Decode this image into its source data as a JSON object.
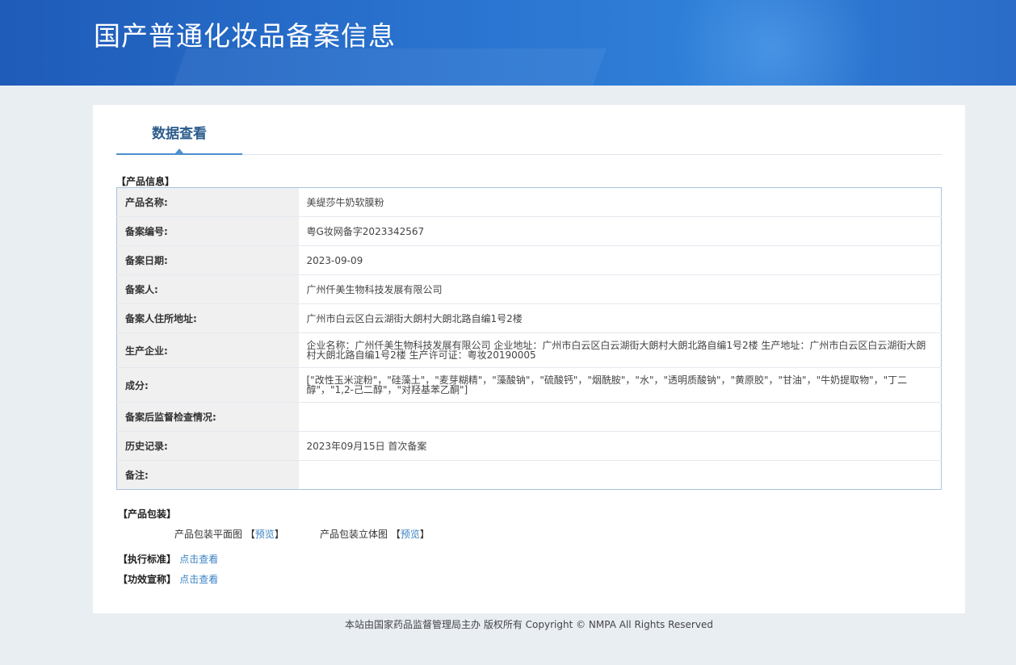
{
  "header": {
    "title": "国产普通化妆品备案信息"
  },
  "tab": {
    "label": "数据查看"
  },
  "product_info": {
    "section_label": "【产品信息】",
    "rows": [
      {
        "label": "产品名称:",
        "value": "美缇莎牛奶软膜粉"
      },
      {
        "label": "备案编号:",
        "value": "粤G妆网备字2023342567"
      },
      {
        "label": "备案日期:",
        "value": "2023-09-09"
      },
      {
        "label": "备案人:",
        "value": "广州仟美生物科技发展有限公司"
      },
      {
        "label": "备案人住所地址:",
        "value": "广州市白云区白云湖街大朗村大朗北路自编1号2楼"
      },
      {
        "label": "生产企业:",
        "value": "企业名称：广州仟美生物科技发展有限公司 企业地址：广州市白云区白云湖街大朗村大朗北路自编1号2楼 生产地址：广州市白云区白云湖街大朗村大朗北路自编1号2楼 生产许可证：粤妆20190005"
      },
      {
        "label": "成分:",
        "value": "[\"改性玉米淀粉\"，\"硅藻土\"，\"麦芽糊精\"，\"藻酸钠\"，\"硫酸钙\"，\"烟酰胺\"，\"水\"，\"透明质酸钠\"，\"黄原胶\"，\"甘油\"，\"牛奶提取物\"，\"丁二醇\"，\"1,2-己二醇\"，\"对羟基苯乙酮\"]"
      },
      {
        "label": "备案后监督检查情况:",
        "value": ""
      },
      {
        "label": "历史记录:",
        "value": "2023年09月15日 首次备案"
      },
      {
        "label": "备注:",
        "value": ""
      }
    ]
  },
  "packaging": {
    "section_label": "【产品包装】",
    "flat_label": "产品包装平面图",
    "flat_link": "预览",
    "stereo_label": "产品包装立体图",
    "stereo_link": "预览"
  },
  "standard": {
    "label": "【执行标准】",
    "link": "点击查看"
  },
  "efficacy": {
    "label": "【功效宣称】",
    "link": "点击查看"
  },
  "footer": {
    "text": "本站由国家药品监督管理局主办 版权所有 Copyright © NMPA All Rights Reserved"
  }
}
